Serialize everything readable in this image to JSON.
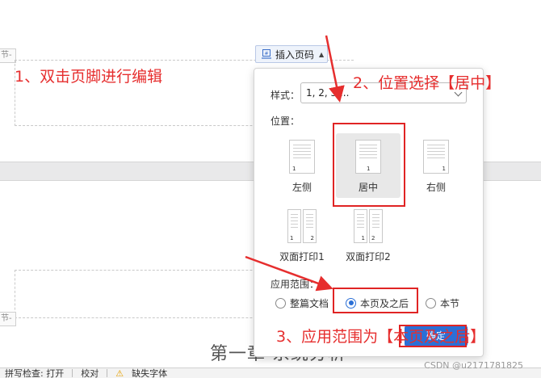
{
  "document": {
    "section_tag_top": "节-",
    "section_tag_bottom": "节-",
    "chapter_title": "第一章 系统分析"
  },
  "toolbar": {
    "insert_page_number_label": "插入页码",
    "icon": "page-number-icon"
  },
  "dialog": {
    "style_label": "样式：",
    "style_value": "1, 2, 3 ...",
    "position_label": "位置：",
    "positions": [
      {
        "label": "左侧",
        "number": "1",
        "selected": false
      },
      {
        "label": "居中",
        "number": "1",
        "selected": true
      },
      {
        "label": "右侧",
        "number": "1",
        "selected": false
      },
      {
        "label": "双面打印1",
        "numbers": [
          "1",
          "2"
        ],
        "selected": false
      },
      {
        "label": "双面打印2",
        "numbers": [
          "1",
          "2"
        ],
        "selected": false
      }
    ],
    "range_label": "应用范围：",
    "range_options": [
      {
        "label": "整篇文档",
        "checked": false
      },
      {
        "label": "本页及之后",
        "checked": true
      },
      {
        "label": "本节",
        "checked": false
      }
    ],
    "ok_label": "确定"
  },
  "annotations": {
    "step1": "1、双击页脚进行编辑",
    "step2": "2、位置选择【居中】",
    "step3": "3、应用范围为【本页及之后】"
  },
  "status_bar": {
    "spell_check": "拼写检查: 打开",
    "proofread": "校对",
    "missing_font": "缺失字体"
  },
  "watermark": "CSDN @u2171781825",
  "colors": {
    "annotation_red": "#e62e2e",
    "accent_blue": "#2b6fd6"
  }
}
